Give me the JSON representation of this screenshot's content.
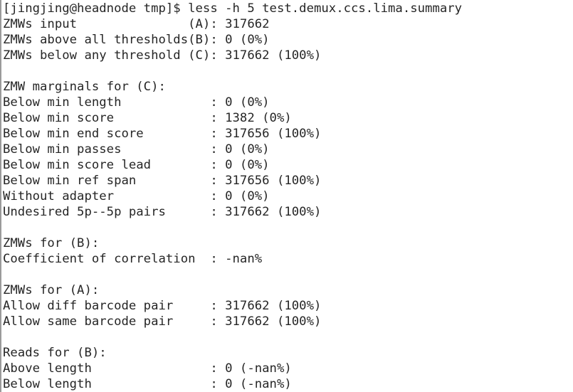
{
  "window": {
    "kind": "terminal-output",
    "background_color": "#ffffff",
    "text_color": "#262626",
    "border_color": "#9a9a9a"
  },
  "prompt": {
    "user": "jingjing",
    "host": "headnode",
    "directory": "tmp",
    "symbol": "$",
    "full_prompt": "[jingjing@headnode tmp]$",
    "command": "less -h 5 test.demux.ccs.lima.summary",
    "command_line": "[jingjing@headnode tmp]$ less -h 5 test.demux.ccs.lima.summary"
  },
  "summary": {
    "label_width": 28,
    "top_stats": [
      {
        "label": "ZMWs input",
        "marker": "(A)",
        "value": "317662",
        "percent": ""
      },
      {
        "label": "ZMWs above all thresholds",
        "marker": "(B)",
        "value": "0",
        "percent": "(0%)"
      },
      {
        "label": "ZMWs below any threshold",
        "marker": "(C)",
        "value": "317662",
        "percent": "(100%)"
      }
    ],
    "sections": [
      {
        "heading": "ZMW marginals for (C):",
        "rows": [
          {
            "label": "Below min length",
            "value": "0",
            "percent": "(0%)"
          },
          {
            "label": "Below min score",
            "value": "1382",
            "percent": "(0%)"
          },
          {
            "label": "Below min end score",
            "value": "317656",
            "percent": "(100%)"
          },
          {
            "label": "Below min passes",
            "value": "0",
            "percent": "(0%)"
          },
          {
            "label": "Below min score lead",
            "value": "0",
            "percent": "(0%)"
          },
          {
            "label": "Below min ref span",
            "value": "317656",
            "percent": "(100%)"
          },
          {
            "label": "Without adapter",
            "value": "0",
            "percent": "(0%)"
          },
          {
            "label": "Undesired 5p--5p pairs",
            "value": "317662",
            "percent": "(100%)"
          }
        ]
      },
      {
        "heading": "ZMWs for (B):",
        "rows": [
          {
            "label": "Coefficient of correlation",
            "value": "-nan%",
            "percent": ""
          }
        ]
      },
      {
        "heading": "ZMWs for (A):",
        "rows": [
          {
            "label": "Allow diff barcode pair",
            "value": "317662",
            "percent": "(100%)"
          },
          {
            "label": "Allow same barcode pair",
            "value": "317662",
            "percent": "(100%)"
          }
        ]
      },
      {
        "heading": "Reads for (B):",
        "rows": [
          {
            "label": "Above length",
            "value": "0",
            "percent": "(-nan%)"
          },
          {
            "label": "Below length",
            "value": "0",
            "percent": "(-nan%)"
          }
        ]
      }
    ]
  }
}
